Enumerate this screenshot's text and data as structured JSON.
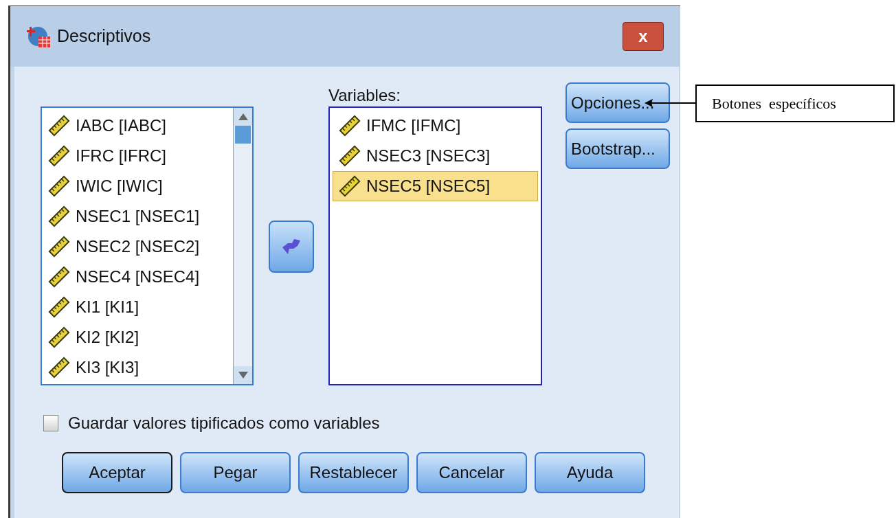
{
  "window": {
    "title": "Descriptivos",
    "close": "x"
  },
  "source_list": {
    "items": [
      {
        "label": "IABC [IABC]",
        "selected": false
      },
      {
        "label": "IFRC [IFRC]",
        "selected": false
      },
      {
        "label": "IWIC [IWIC]",
        "selected": false
      },
      {
        "label": "NSEC1 [NSEC1]",
        "selected": false
      },
      {
        "label": "NSEC2 [NSEC2]",
        "selected": false
      },
      {
        "label": "NSEC4 [NSEC4]",
        "selected": false
      },
      {
        "label": "KI1 [KI1]",
        "selected": false
      },
      {
        "label": "KI2 [KI2]",
        "selected": false
      },
      {
        "label": "KI3 [KI3]",
        "selected": false
      }
    ]
  },
  "variables": {
    "label": "Variables:",
    "items": [
      {
        "label": "IFMC [IFMC]",
        "selected": false
      },
      {
        "label": "NSEC3 [NSEC3]",
        "selected": false
      },
      {
        "label": "NSEC5 [NSEC5]",
        "selected": true
      }
    ]
  },
  "side_buttons": [
    "Opciones...",
    "Bootstrap..."
  ],
  "checkbox": {
    "label": "Guardar valores tipificados como variables",
    "checked": false
  },
  "buttons": [
    {
      "label": "Aceptar",
      "default": true
    },
    {
      "label": "Pegar",
      "default": false
    },
    {
      "label": "Restablecer",
      "default": false
    },
    {
      "label": "Cancelar",
      "default": false
    },
    {
      "label": "Ayuda",
      "default": false
    }
  ],
  "annotation": {
    "text": "Botones  específicos"
  }
}
